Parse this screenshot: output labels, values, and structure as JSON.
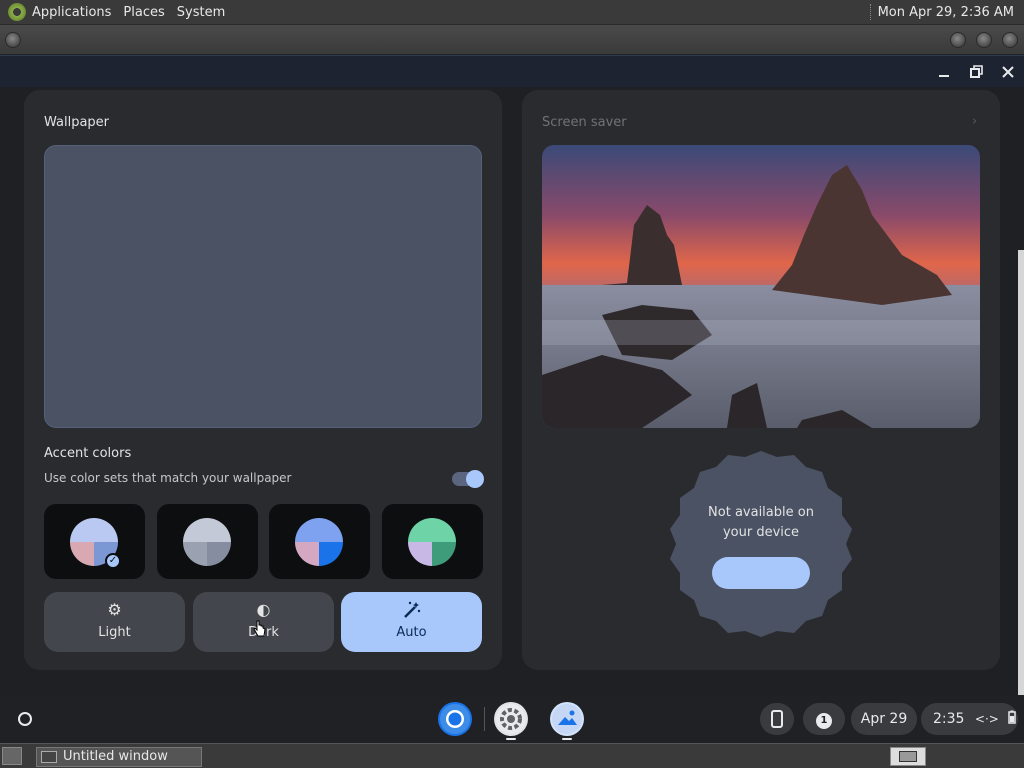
{
  "top_panel": {
    "menus": [
      "Applications",
      "Places",
      "System"
    ],
    "clock": "Mon Apr 29,  2:36 AM"
  },
  "window": {
    "controls": [
      "minimize-icon",
      "restore-icon",
      "close-icon"
    ]
  },
  "wallpaper": {
    "title": "Wallpaper",
    "preview_color": "#4a5263"
  },
  "accent": {
    "title": "Accent colors",
    "description": "Use color sets that match your wallpaper",
    "toggle_on": true,
    "swatches": [
      {
        "colors": [
          "#b9c9f2",
          "#d8a9b3",
          "#7b98d4"
        ],
        "selected": true
      },
      {
        "colors": [
          "#c3c9d6",
          "#9aa1b0",
          "#868da0"
        ],
        "selected": false
      },
      {
        "colors": [
          "#7ea1f0",
          "#d4a8c0",
          "#1a73e8"
        ],
        "selected": false
      },
      {
        "colors": [
          "#6fd3a8",
          "#c8b8e6",
          "#3e9c7a"
        ],
        "selected": false
      }
    ]
  },
  "modes": [
    {
      "label": "Light",
      "icon": "gear-icon",
      "active": false
    },
    {
      "label": "Dark",
      "icon": "half-circle-icon",
      "active": false
    },
    {
      "label": "Auto",
      "icon": "magic-wand-icon",
      "active": true
    }
  ],
  "screensaver": {
    "title": "Screen saver",
    "badge_text": "Not available on your device"
  },
  "shelf": {
    "date": "Apr 29",
    "time": "2:35",
    "notification_count": "1"
  },
  "taskbar": {
    "window_title": "Untitled window"
  },
  "colors": {
    "accent": "#a8c7fa",
    "card": "#2a2b2f",
    "background": "#1f2023"
  }
}
